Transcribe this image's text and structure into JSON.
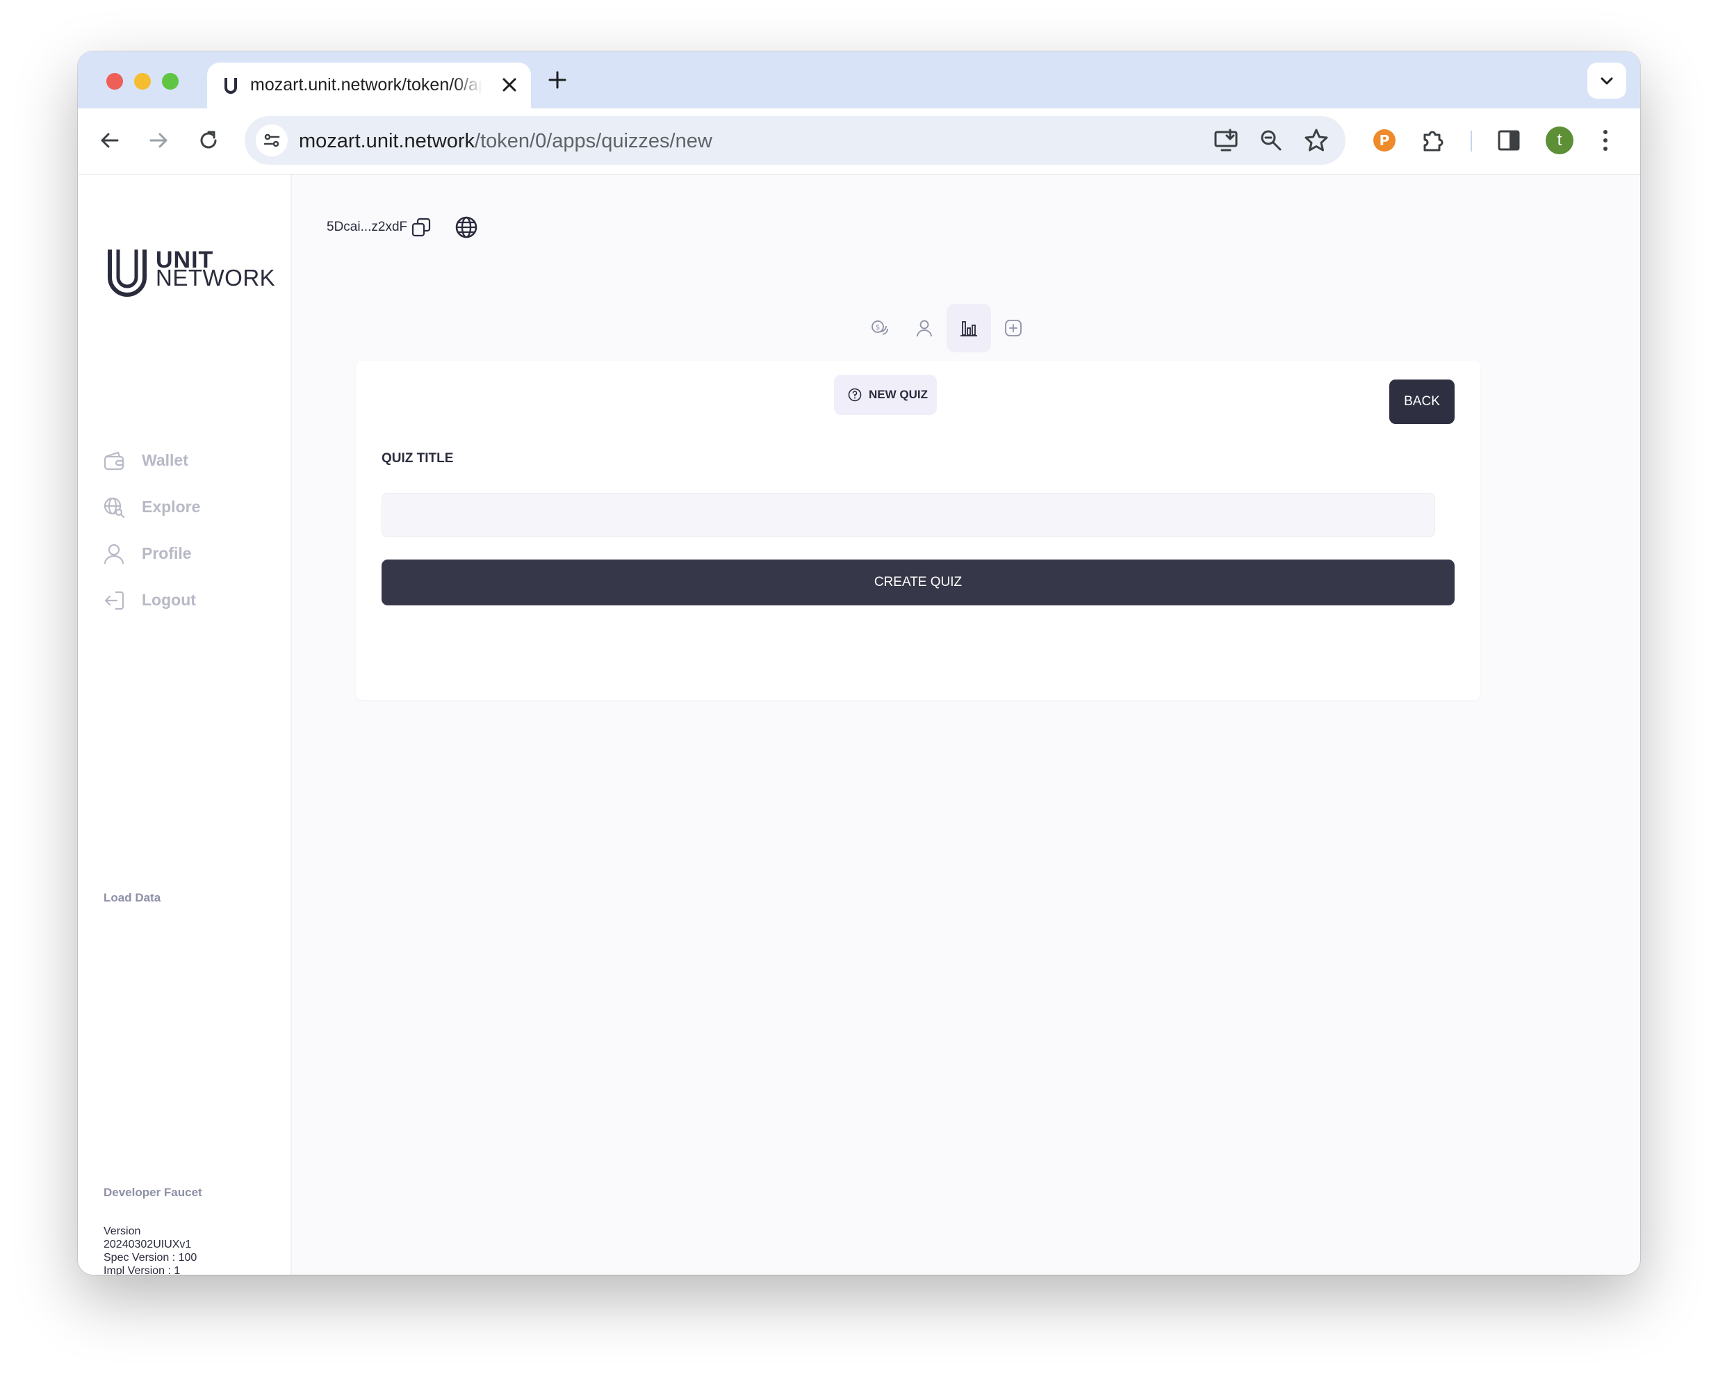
{
  "browser": {
    "tab_title": "mozart.unit.network/token/0/apps/quizzes/new",
    "url_host": "mozart.unit.network",
    "url_path": "/token/0/apps/quizzes/new",
    "profile_initial": "t"
  },
  "sidebar": {
    "logo_line1": "UNIT",
    "logo_line2": "NETWORK",
    "nav": [
      {
        "label": "Wallet",
        "icon": "wallet-icon"
      },
      {
        "label": "Explore",
        "icon": "globe-search-icon"
      },
      {
        "label": "Profile",
        "icon": "user-icon"
      },
      {
        "label": "Logout",
        "icon": "logout-icon"
      }
    ],
    "load_data": "Load Data",
    "developer_faucet": "Developer Faucet",
    "version": {
      "line1": "Version",
      "line2": "20240302UIUXv1",
      "line3": "Spec Version : 100",
      "line4": "Impl Version : 1"
    }
  },
  "header": {
    "address": "5Dcai...z2xdF"
  },
  "app_nav": [
    {
      "icon": "coins-icon",
      "active": false
    },
    {
      "icon": "user-icon",
      "active": false
    },
    {
      "icon": "bar-chart-icon",
      "active": true
    },
    {
      "icon": "plus-square-icon",
      "active": false
    }
  ],
  "quiz_form": {
    "badge": "NEW QUIZ",
    "back_label": "BACK",
    "title_label": "QUIZ TITLE",
    "title_value": "",
    "title_placeholder": "",
    "create_label": "CREATE QUIZ"
  },
  "colors": {
    "primary_button": "#363748",
    "accent_bg": "#efeef9",
    "muted_nav_text": "#b7b9c6"
  }
}
